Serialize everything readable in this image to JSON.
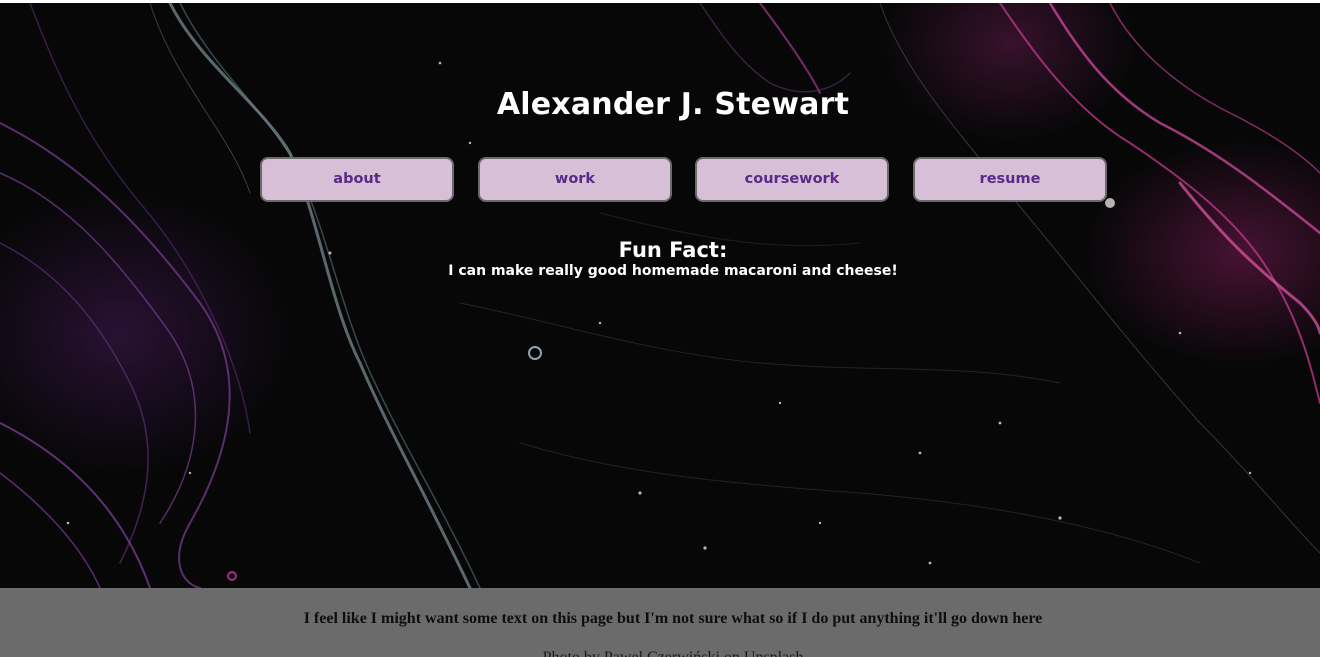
{
  "header": {
    "title": "Alexander J. Stewart"
  },
  "nav": {
    "items": [
      {
        "label": "about"
      },
      {
        "label": "work"
      },
      {
        "label": "coursework"
      },
      {
        "label": "resume"
      }
    ]
  },
  "fun_fact": {
    "heading": "Fun Fact:",
    "text": "I can make really good homemade macaroni and cheese!"
  },
  "footer": {
    "text": "I feel like I might want some text on this page but I'm not sure what so if I do put anything it'll go down here",
    "credit": "Photo by Pawel Czerwiński on Unsplash"
  },
  "colors": {
    "background": "#070708",
    "button_fill": "#d7bfd8",
    "button_text": "#5a2a86",
    "button_border": "#6b6b6b",
    "footer_bg": "#6b6b6b"
  }
}
